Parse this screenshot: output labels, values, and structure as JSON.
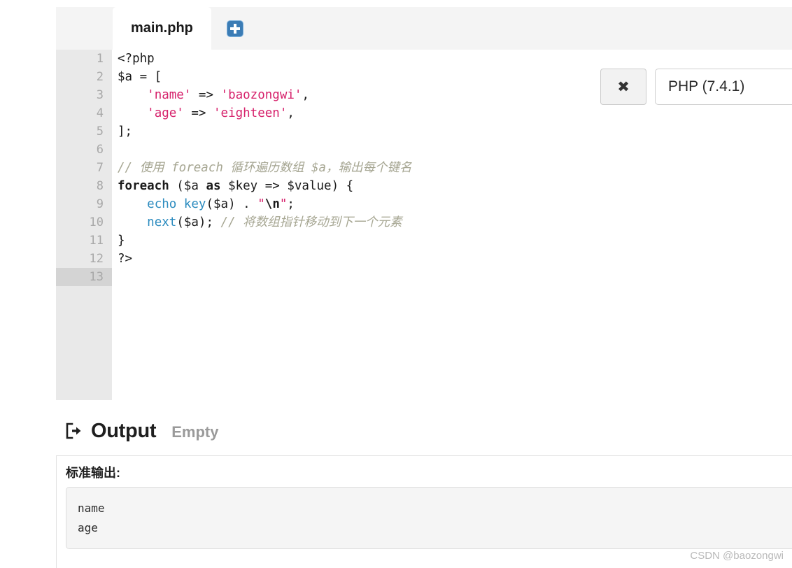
{
  "editor": {
    "tabs": [
      {
        "label": "main.php",
        "active": true
      }
    ],
    "add_tab_icon": "plus-icon",
    "active_line": 13,
    "total_lines": 13,
    "line_numbers": [
      "1",
      "2",
      "3",
      "4",
      "5",
      "6",
      "7",
      "8",
      "9",
      "10",
      "11",
      "12",
      "13"
    ],
    "code_lines": [
      {
        "n": 1,
        "tokens": [
          {
            "t": "<?php",
            "c": "plain"
          }
        ]
      },
      {
        "n": 2,
        "tokens": [
          {
            "t": "$a = [",
            "c": "plain"
          }
        ]
      },
      {
        "n": 3,
        "tokens": [
          {
            "t": "    ",
            "c": "plain"
          },
          {
            "t": "'name'",
            "c": "str"
          },
          {
            "t": " => ",
            "c": "plain"
          },
          {
            "t": "'baozongwi'",
            "c": "str"
          },
          {
            "t": ",",
            "c": "plain"
          }
        ]
      },
      {
        "n": 4,
        "tokens": [
          {
            "t": "    ",
            "c": "plain"
          },
          {
            "t": "'age'",
            "c": "str"
          },
          {
            "t": " => ",
            "c": "plain"
          },
          {
            "t": "'eighteen'",
            "c": "str"
          },
          {
            "t": ",",
            "c": "plain"
          }
        ]
      },
      {
        "n": 5,
        "tokens": [
          {
            "t": "];",
            "c": "plain"
          }
        ]
      },
      {
        "n": 6,
        "tokens": [
          {
            "t": "",
            "c": "plain"
          }
        ]
      },
      {
        "n": 7,
        "tokens": [
          {
            "t": "// 使用 foreach 循环遍历数组 $a，输出每个键名",
            "c": "com"
          }
        ]
      },
      {
        "n": 8,
        "tokens": [
          {
            "t": "foreach",
            "c": "kw"
          },
          {
            "t": " ($a ",
            "c": "plain"
          },
          {
            "t": "as",
            "c": "kw"
          },
          {
            "t": " $key => $value) {",
            "c": "plain"
          }
        ]
      },
      {
        "n": 9,
        "tokens": [
          {
            "t": "    ",
            "c": "plain"
          },
          {
            "t": "echo",
            "c": "fn"
          },
          {
            "t": " ",
            "c": "plain"
          },
          {
            "t": "key",
            "c": "fn"
          },
          {
            "t": "($a) . ",
            "c": "plain"
          },
          {
            "t": "\"",
            "c": "str"
          },
          {
            "t": "\\n",
            "c": "esc"
          },
          {
            "t": "\"",
            "c": "str"
          },
          {
            "t": ";",
            "c": "plain"
          }
        ]
      },
      {
        "n": 10,
        "tokens": [
          {
            "t": "    ",
            "c": "plain"
          },
          {
            "t": "next",
            "c": "fn"
          },
          {
            "t": "($a); ",
            "c": "plain"
          },
          {
            "t": "// 将数组指针移动到下一个元素",
            "c": "com"
          }
        ]
      },
      {
        "n": 11,
        "tokens": [
          {
            "t": "}",
            "c": "plain"
          }
        ]
      },
      {
        "n": 12,
        "tokens": [
          {
            "t": "?>",
            "c": "plain"
          }
        ]
      },
      {
        "n": 13,
        "tokens": [
          {
            "t": "",
            "c": "plain"
          }
        ]
      }
    ]
  },
  "run_controls": {
    "close_label": "✖",
    "language": "PHP (7.4.1)"
  },
  "output": {
    "title": "Output",
    "status": "Empty",
    "icon": "sign-out-icon",
    "stdout_label": "标准输出:",
    "stdout_lines": [
      "name",
      "age"
    ]
  },
  "watermark": "CSDN @baozongwi",
  "colors": {
    "string": "#d6216b",
    "comment": "#a6a692",
    "function": "#2b8bbf",
    "accent_blue": "#3b7cb5",
    "gutter_bg": "#e9e9e9",
    "active_line_bg": "#d4d4d4"
  }
}
